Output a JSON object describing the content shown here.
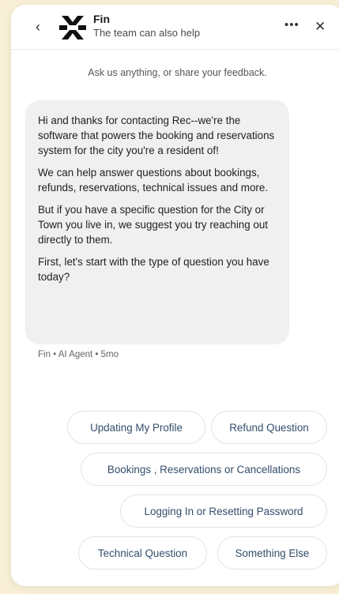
{
  "header": {
    "title": "Fin",
    "subtitle": "The team can also help",
    "back_glyph": "‹",
    "more_glyph": "•••",
    "close_glyph": "✕"
  },
  "intro": "Ask us anything, or share your feedback.",
  "message": {
    "paragraphs": [
      "Hi and thanks for contacting Rec--we're the software that powers the booking and reservations system for the city you're a resident of!",
      "We can help answer questions about bookings, refunds, reservations, technical issues and more.",
      "But if you have a specific question for the City or Town you live in, we suggest you try reaching out directly to them.",
      "First, let's start with the type of question you have today?"
    ],
    "meta": "Fin • AI Agent • 5mo"
  },
  "options": [
    "Updating My Profile",
    "Refund Question",
    "Bookings , Reservations or Cancellations",
    "Logging In or Resetting Password",
    "Technical Question",
    "Something Else"
  ],
  "colors": {
    "background": "#f8efd6",
    "chip_text": "#334e6b",
    "bubble": "#f0f0f0"
  }
}
